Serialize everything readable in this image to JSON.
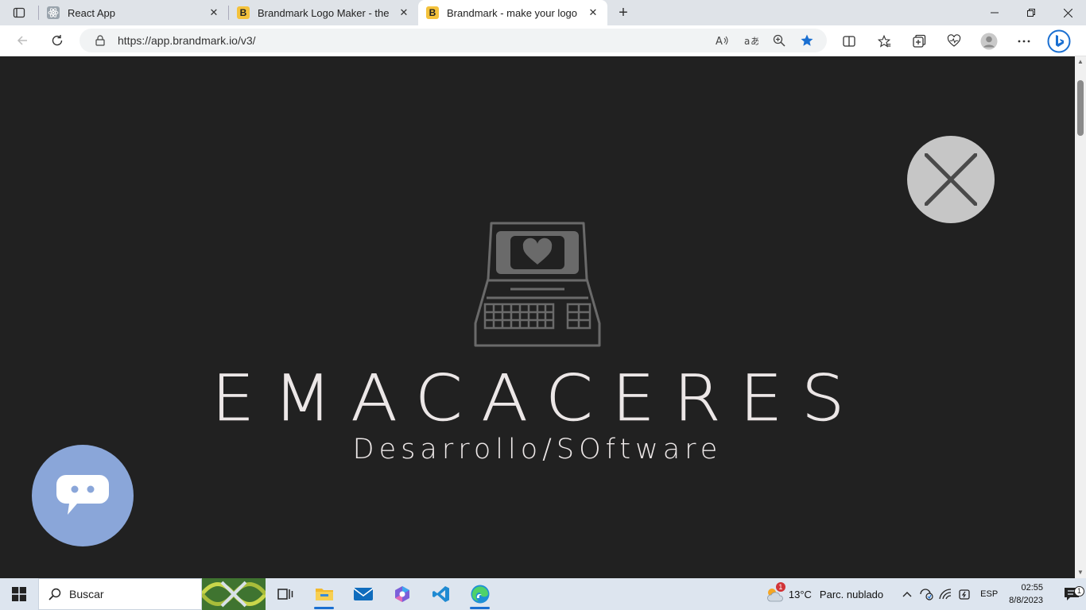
{
  "browser": {
    "tabs": [
      {
        "title": "React App",
        "favicon": "react-icon",
        "active": false
      },
      {
        "title": "Brandmark Logo Maker - the mo",
        "favicon": "B",
        "active": false
      },
      {
        "title": "Brandmark - make your logo in m",
        "favicon": "B",
        "active": true
      }
    ],
    "new_tab": "+",
    "close_glyph": "✕",
    "address": {
      "url": "https://app.brandmark.io/v3/"
    }
  },
  "page": {
    "brand_name": "EMACACERES",
    "tagline": "Desarrollo/SOftware",
    "close_button": "close-icon",
    "chat_button": "chat-icon"
  },
  "taskbar": {
    "search_label": "Buscar",
    "weather": {
      "temp": "13°C",
      "desc": "Parc. nublado",
      "badge": "1"
    },
    "lang": "ESP",
    "time": "02:55",
    "date": "8/8/2023",
    "notifications": "1"
  },
  "colors": {
    "page_bg": "#212121",
    "brand_text": "#ece7e7",
    "logo_gray": "#6a6a6a",
    "close_bg": "#c6c6c6",
    "chat_bg": "#8aa6d9",
    "accent": "#1a6fd1"
  }
}
